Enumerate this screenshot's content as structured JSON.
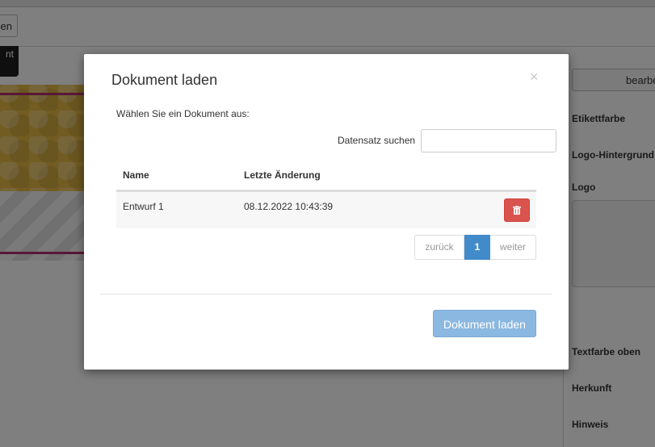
{
  "background": {
    "toolbar_button_label": "en",
    "dark_button_label": "nt",
    "edit_button_label": "bearbe",
    "right_panel_labels": [
      "Etikettfarbe",
      "Logo-Hintergrund",
      "Logo",
      "Textfarbe oben",
      "Herkunft",
      "Hinweis"
    ]
  },
  "modal": {
    "title": "Dokument laden",
    "close_symbol": "×",
    "intro": "Wählen Sie ein Dokument aus:",
    "search_label": "Datensatz suchen",
    "search_value": "",
    "columns": [
      "Name",
      "Letzte Änderung"
    ],
    "rows": [
      {
        "name": "Entwurf 1",
        "modified": "08.12.2022 10:43:39"
      }
    ],
    "pagination": {
      "prev": "zurück",
      "current": "1",
      "next": "weiter"
    },
    "load_button": "Dokument laden"
  },
  "colors": {
    "delete": "#d9534f",
    "primary": "#428bca",
    "primary_disabled": "#8bb8e0"
  }
}
